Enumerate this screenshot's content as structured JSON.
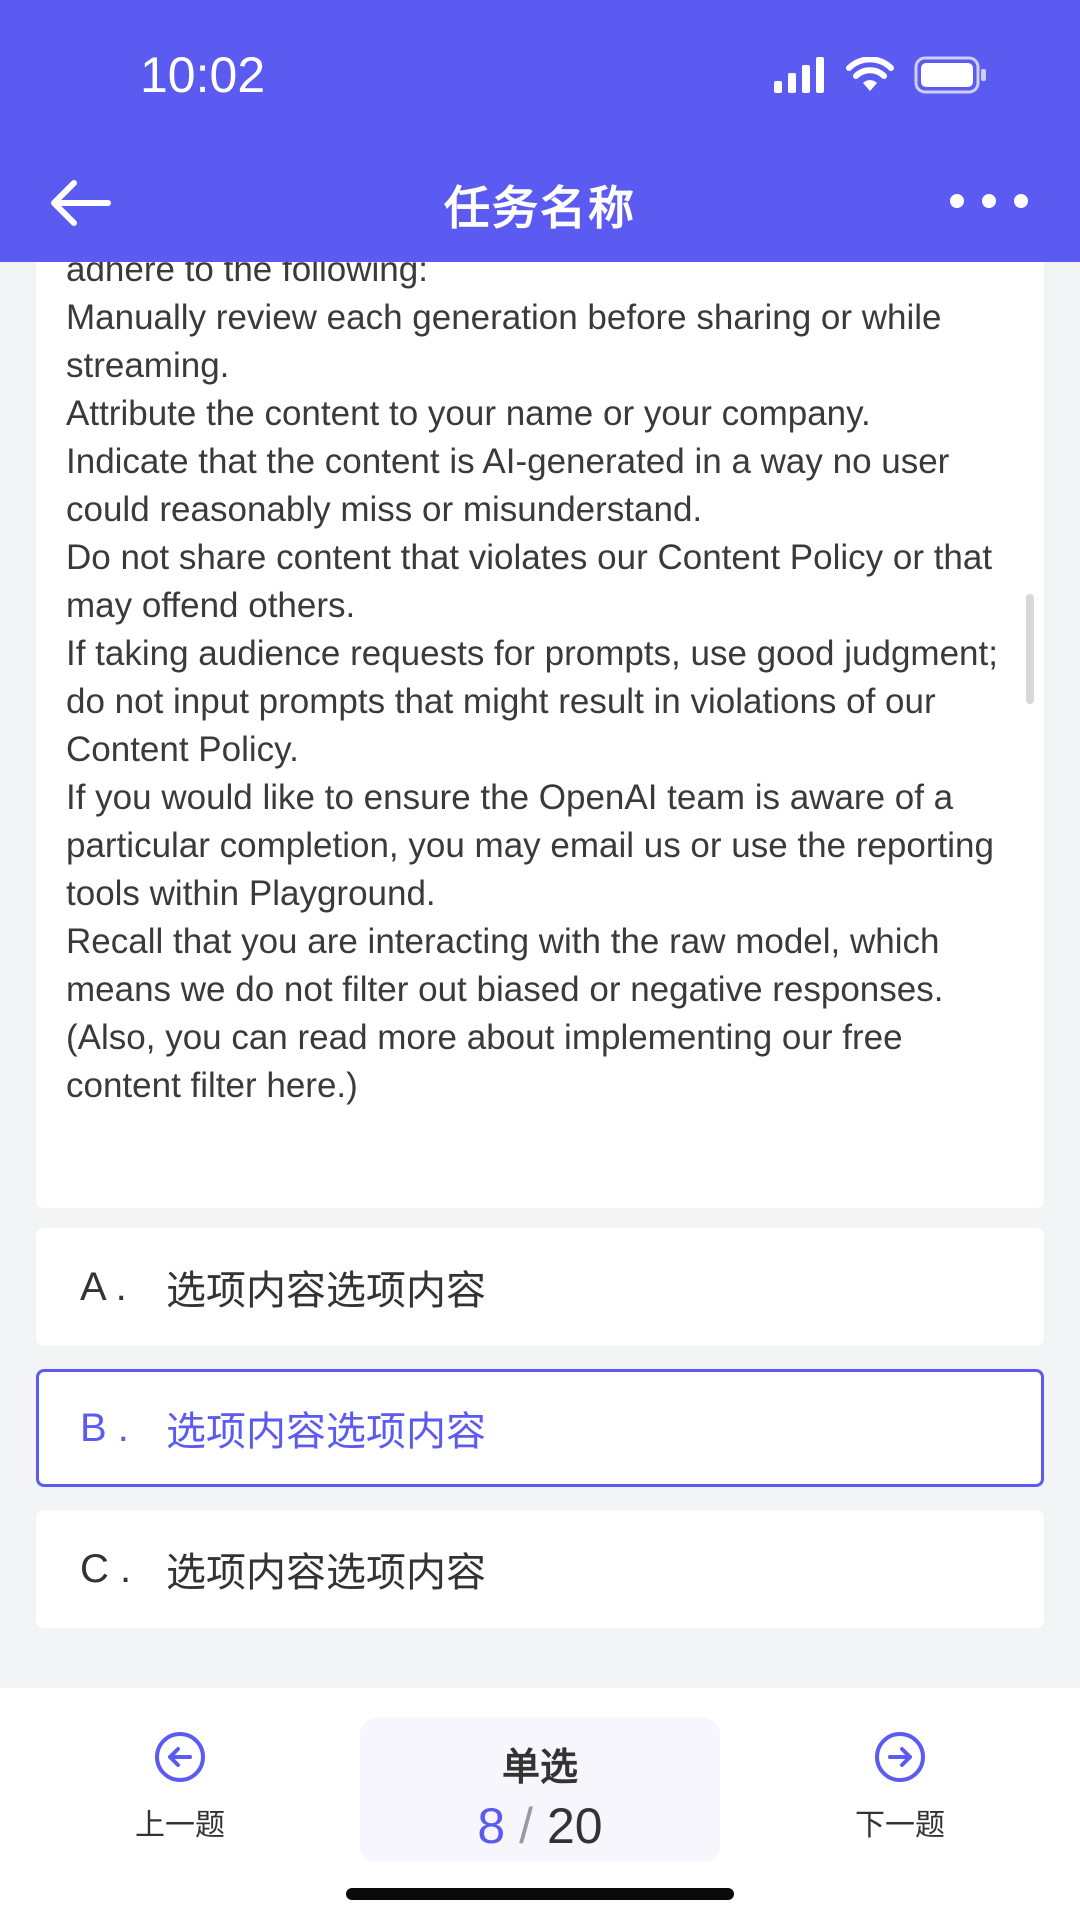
{
  "status": {
    "time": "10:02",
    "icons": [
      "signal-icon",
      "wifi-icon",
      "battery-icon"
    ]
  },
  "header": {
    "title": "任务名称",
    "back_icon": "arrow-left-icon",
    "more_icon": "more-dots-icon"
  },
  "article": {
    "lines": [
      "adhere to the following:",
      "Manually review each generation before sharing or while streaming.",
      "Attribute the content to your name or your company.",
      "Indicate that the content is AI-generated in a way no user could reasonably miss or misunderstand.",
      "Do not share content that violates our Content Policy or that may offend others.",
      "If taking audience requests for prompts, use good judgment; do not input prompts that might result in violations of our Content Policy.",
      "If you would like to ensure the OpenAI team is aware of a particular completion, you may email us or use the reporting tools within Playground.",
      "Recall that you are interacting with the raw model, which means we do not filter out biased or negative responses. (Also, you can read more about implementing our free content filter here.)"
    ]
  },
  "options": [
    {
      "letter": "A .",
      "text": "选项内容选项内容",
      "selected": false
    },
    {
      "letter": "B .",
      "text": "选项内容选项内容",
      "selected": true
    },
    {
      "letter": "C .",
      "text": "选项内容选项内容",
      "selected": false
    }
  ],
  "footer": {
    "prev_label": "上一题",
    "next_label": "下一题",
    "question_type": "单选",
    "current": "8",
    "separator": "/",
    "total": "20",
    "prev_icon": "arrow-left-circle-icon",
    "next_icon": "arrow-right-circle-icon"
  },
  "colors": {
    "accent": "#5b5bf2",
    "background": "#f3f4f6",
    "text": "#3a3a3c"
  }
}
